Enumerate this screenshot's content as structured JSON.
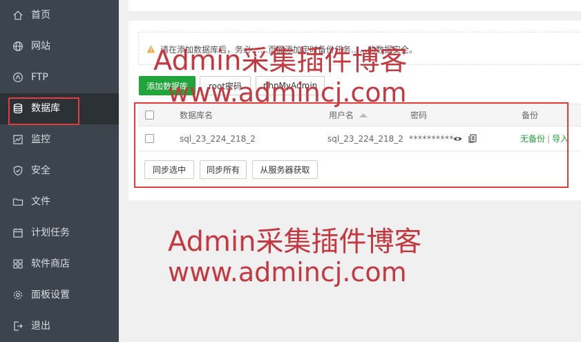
{
  "sidebar": {
    "items": [
      {
        "label": "首页",
        "icon": "home-icon"
      },
      {
        "label": "网站",
        "icon": "globe-icon"
      },
      {
        "label": "FTP",
        "icon": "ftp-icon"
      },
      {
        "label": "数据库",
        "icon": "database-icon",
        "active": true
      },
      {
        "label": "监控",
        "icon": "monitor-icon"
      },
      {
        "label": "安全",
        "icon": "shield-icon"
      },
      {
        "label": "文件",
        "icon": "folder-icon"
      },
      {
        "label": "计划任务",
        "icon": "calendar-icon"
      },
      {
        "label": "软件商店",
        "icon": "apps-icon"
      },
      {
        "label": "面板设置",
        "icon": "gear-icon"
      },
      {
        "label": "退出",
        "icon": "logout-icon"
      }
    ]
  },
  "notice": {
    "text": "请在添加数据库后，务必……页面添加定时备份任务……的数据安全。"
  },
  "toolbar": {
    "add_db": "添加数据库",
    "root_pwd": "root密码",
    "phpmyadmin": "phpMyAdmin"
  },
  "table": {
    "headers": {
      "name": "数据库名",
      "user": "用户名",
      "password": "密码",
      "backup": "备份"
    },
    "rows": [
      {
        "name": "sql_23_224_218_2",
        "user": "sql_23_224_218_2",
        "password": "**********",
        "backup_none": "无备份",
        "backup_sep": "|",
        "import": "导入"
      }
    ]
  },
  "actions": {
    "sync_selected": "同步选中",
    "sync_all": "同步所有",
    "fetch_server": "从服务器获取"
  },
  "watermark": {
    "line1": "Admin采集插件博客",
    "line2": "www.admincj.com"
  },
  "colors": {
    "sidebar_bg": "#3c444d",
    "accent_green": "#20a53a",
    "annotation_red": "#e23d3d",
    "watermark": "#c6383f"
  }
}
